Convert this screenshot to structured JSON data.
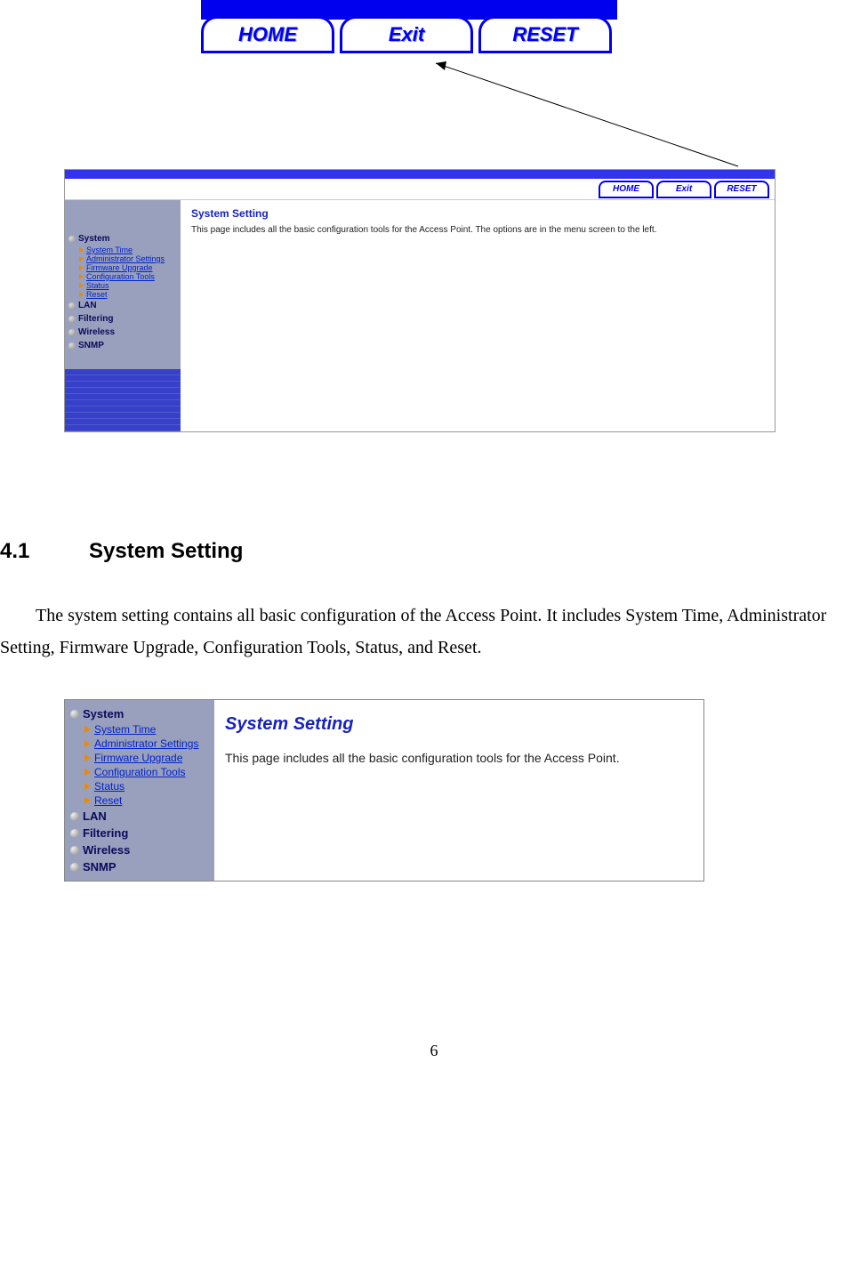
{
  "top_buttons": {
    "home": "HOME",
    "exit": "Exit",
    "reset": "RESET"
  },
  "small_buttons": {
    "home": "HOME",
    "exit": "Exit",
    "reset": "RESET"
  },
  "screenshot1": {
    "title": "System Setting",
    "desc": "This page includes all the basic configuration tools for the Access Point. The options are in the menu screen to the left.",
    "sidebar": {
      "system": "System",
      "subs": [
        "System Time",
        "Administrator Settings",
        "Firmware Upgrade",
        "Configuration Tools",
        "Status",
        "Reset"
      ],
      "lan": "LAN",
      "filtering": "Filtering",
      "wireless": "Wireless",
      "snmp": "SNMP"
    }
  },
  "doc": {
    "heading_num": "4.1",
    "heading_text": "System Setting",
    "para": "The system setting contains all basic configuration of the Access Point. It includes System Time, Administrator Setting, Firmware Upgrade, Configuration Tools, Status, and Reset."
  },
  "screenshot2": {
    "title": "System Setting",
    "desc": "This page includes all the basic configuration tools for the Access Point.",
    "sidebar": {
      "system": "System",
      "subs": [
        "System Time",
        "Administrator Settings",
        "Firmware Upgrade",
        "Configuration Tools",
        "Status",
        "Reset"
      ],
      "lan": "LAN",
      "filtering": "Filtering",
      "wireless": "Wireless",
      "snmp": "SNMP"
    }
  },
  "page_number": "6"
}
